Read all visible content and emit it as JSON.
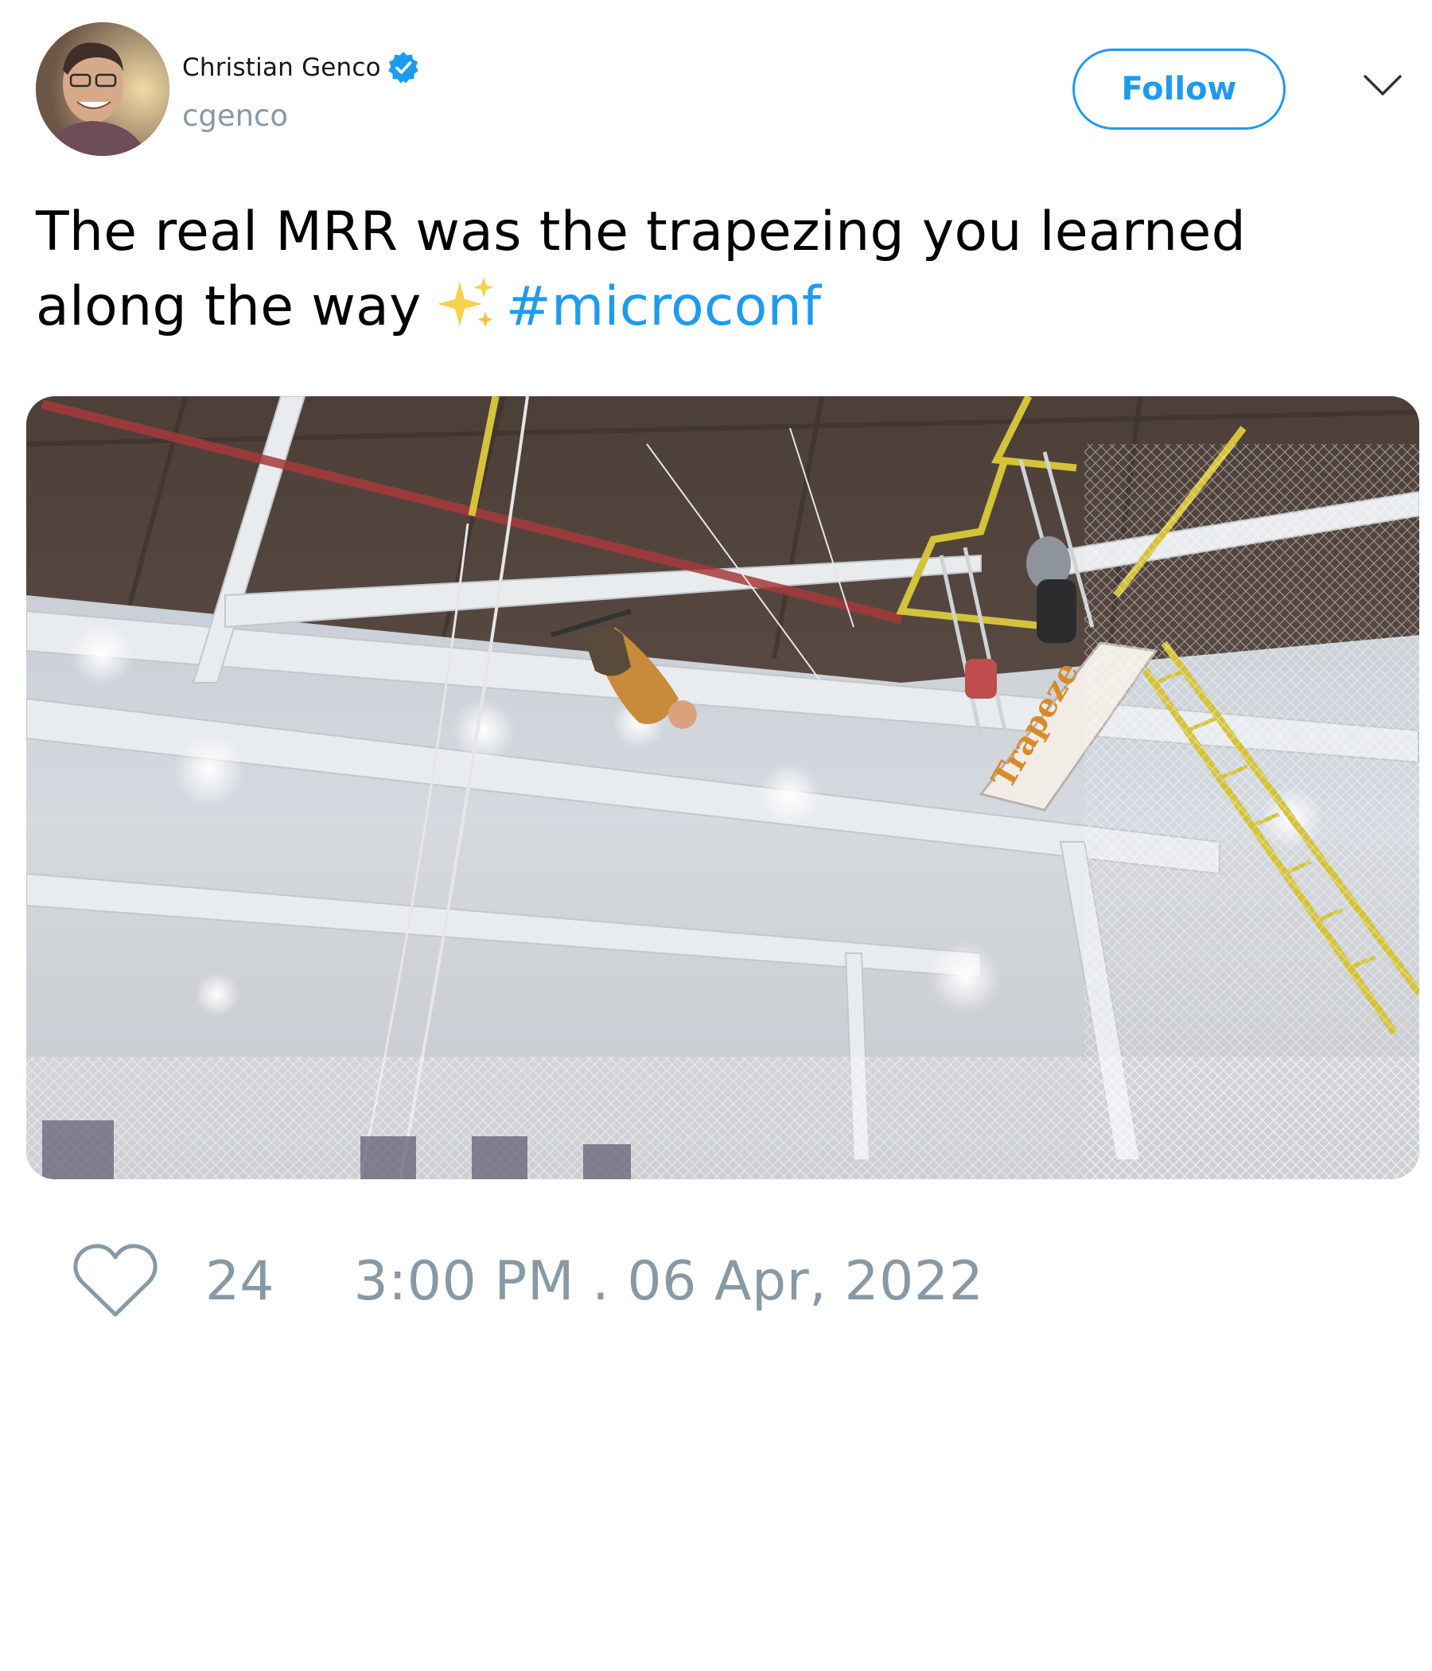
{
  "author": {
    "display_name": "Christian Genco",
    "handle": "cgenco",
    "verified": true
  },
  "header": {
    "follow_label": "Follow"
  },
  "tweet": {
    "text_line1": "The real MRR was the trapezing you learned",
    "text_line2": "along the way",
    "emoji": "sparkles",
    "hashtag": "#microconf"
  },
  "media": {
    "sign_text": "Trapeze"
  },
  "footer": {
    "like_count": "24",
    "timestamp": "3:00 PM . 06 Apr, 2022"
  },
  "colors": {
    "accent": "#1d9bf0",
    "muted": "#8899a6",
    "text": "#000000"
  },
  "icons": [
    "verified-badge-icon",
    "chevron-down-icon",
    "sparkles-icon",
    "heart-icon"
  ]
}
